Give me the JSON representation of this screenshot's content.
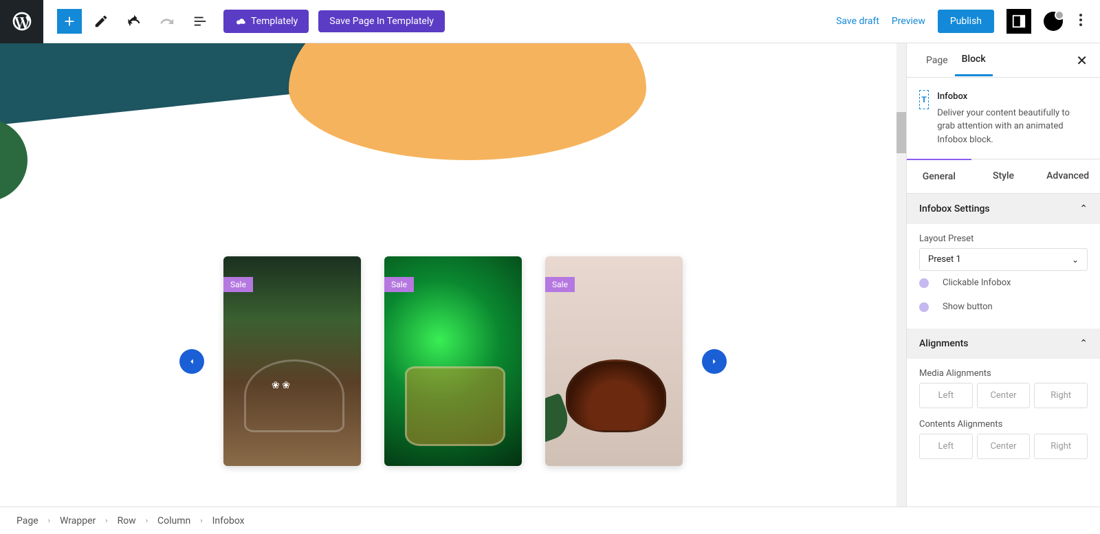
{
  "topbar": {
    "templately_label": "Templately",
    "save_page_label": "Save Page In Templately",
    "save_draft": "Save draft",
    "preview": "Preview",
    "publish": "Publish"
  },
  "carousel": {
    "sale_label": "Sale"
  },
  "sidebar": {
    "tabs": {
      "page": "Page",
      "block": "Block"
    },
    "block_name": "Infobox",
    "block_desc": "Deliver your content beautifully to grab attention with an animated Infobox block.",
    "subtabs": {
      "general": "General",
      "style": "Style",
      "advanced": "Advanced"
    },
    "infobox_settings": {
      "heading": "Infobox Settings",
      "layout_preset_label": "Layout Preset",
      "layout_preset_value": "Preset 1",
      "clickable": "Clickable Infobox",
      "show_button": "Show button"
    },
    "alignments": {
      "heading": "Alignments",
      "media_label": "Media Alignments",
      "contents_label": "Contents Alignments",
      "left": "Left",
      "center": "Center",
      "right": "Right"
    }
  },
  "breadcrumb": [
    "Page",
    "Wrapper",
    "Row",
    "Column",
    "Infobox"
  ]
}
